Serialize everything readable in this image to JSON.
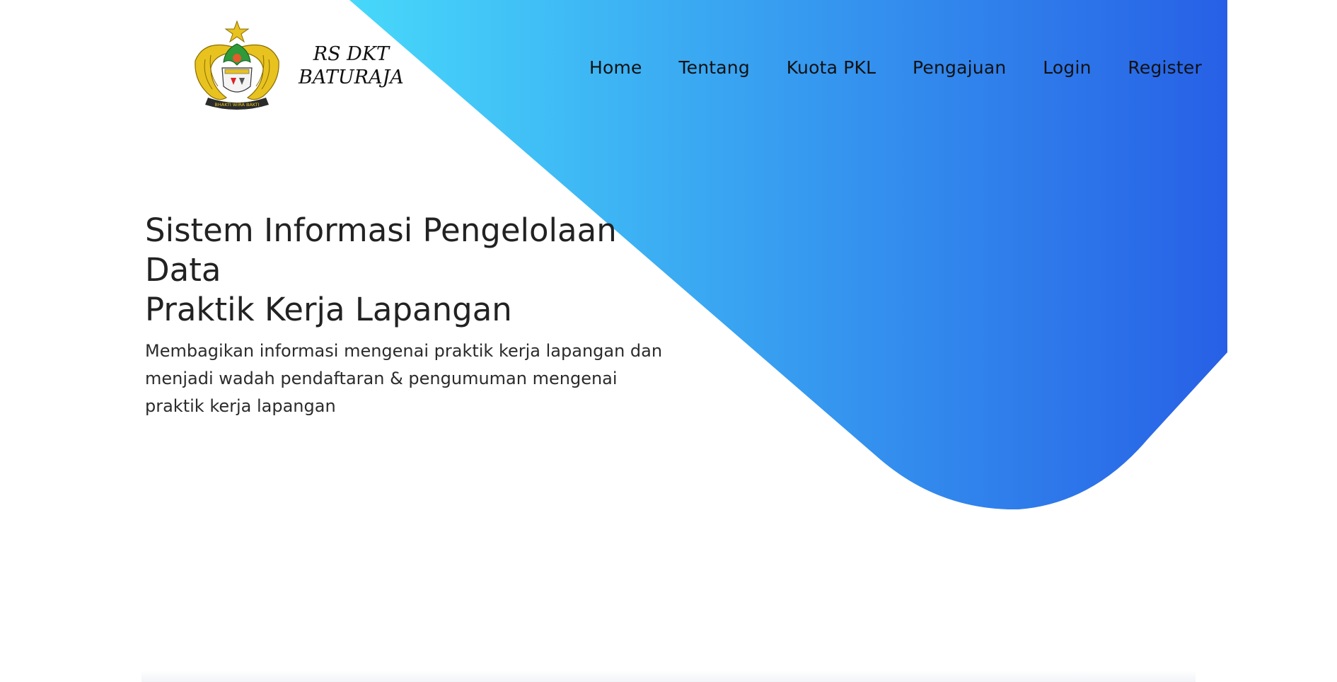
{
  "brand": {
    "line1": "RS DKT",
    "line2": "BATURAJA",
    "emblem_ribbon": "BHAKTI WIRA BAKTI"
  },
  "nav": {
    "items": [
      "Home",
      "Tentang",
      "Kuota PKL",
      "Pengajuan",
      "Login",
      "Register"
    ]
  },
  "hero": {
    "title_line1": "Sistem Informasi Pengelolaan Data",
    "title_line2": "Praktik Kerja Lapangan",
    "description": "Membagikan informasi mengenai praktik kerja lapangan dan menjadi wadah pendaftaran & pengumuman mengenai praktik kerja lapangan"
  },
  "colors": {
    "gradient_start": "#47d8fa",
    "gradient_end": "#2760e6",
    "emblem_gold": "#e8c21f",
    "emblem_green": "#2e9a3a"
  }
}
